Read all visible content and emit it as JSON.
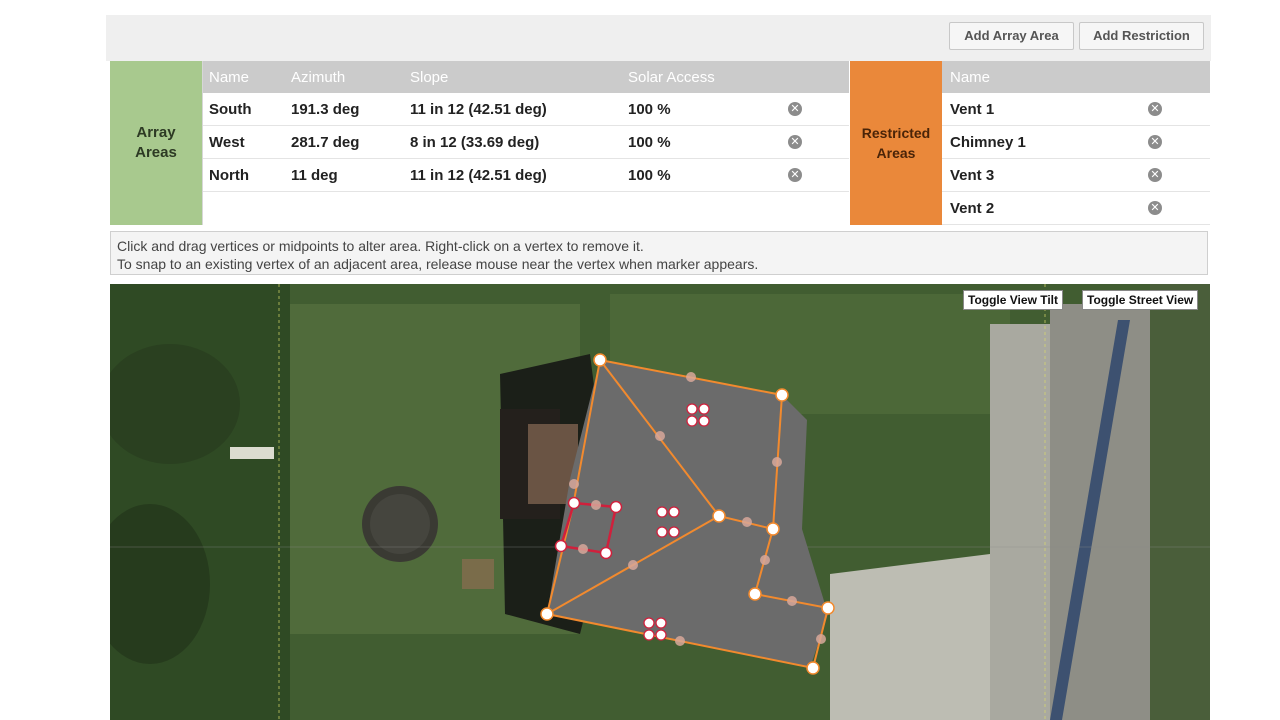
{
  "toolbar": {
    "add_array_label": "Add Array Area",
    "add_restriction_label": "Add Restriction"
  },
  "array_areas": {
    "label_line1": "Array",
    "label_line2": "Areas",
    "headers": [
      "Name",
      "Azimuth",
      "Slope",
      "Solar Access"
    ],
    "rows": [
      {
        "name": "South",
        "azimuth": "191.3 deg",
        "slope": "11 in 12 (42.51 deg)",
        "solar": "100 %"
      },
      {
        "name": "West",
        "azimuth": "281.7 deg",
        "slope": "8 in 12 (33.69 deg)",
        "solar": "100 %"
      },
      {
        "name": "North",
        "azimuth": "11 deg",
        "slope": "11 in 12 (42.51 deg)",
        "solar": "100 %"
      }
    ]
  },
  "restricted_areas": {
    "label_line1": "Restricted",
    "label_line2": "Areas",
    "header": "Name",
    "rows": [
      {
        "name": "Vent 1"
      },
      {
        "name": "Chimney 1"
      },
      {
        "name": "Vent 3"
      },
      {
        "name": "Vent 2"
      }
    ]
  },
  "instructions": {
    "line1": "Click and drag vertices or midpoints to alter area. Right-click on a vertex to remove it.",
    "line2": "To snap to an existing vertex of an adjacent area, release mouse near the vertex when marker appears."
  },
  "map": {
    "toggle_tilt_label": "Toggle View Tilt",
    "toggle_street_label": "Toggle Street View",
    "colors": {
      "array_outline": "#f28a2e",
      "restriction_outline": "#d0203c",
      "roof": "#6b6b6b"
    }
  },
  "icons": {
    "remove": "remove-circle-x-icon"
  }
}
